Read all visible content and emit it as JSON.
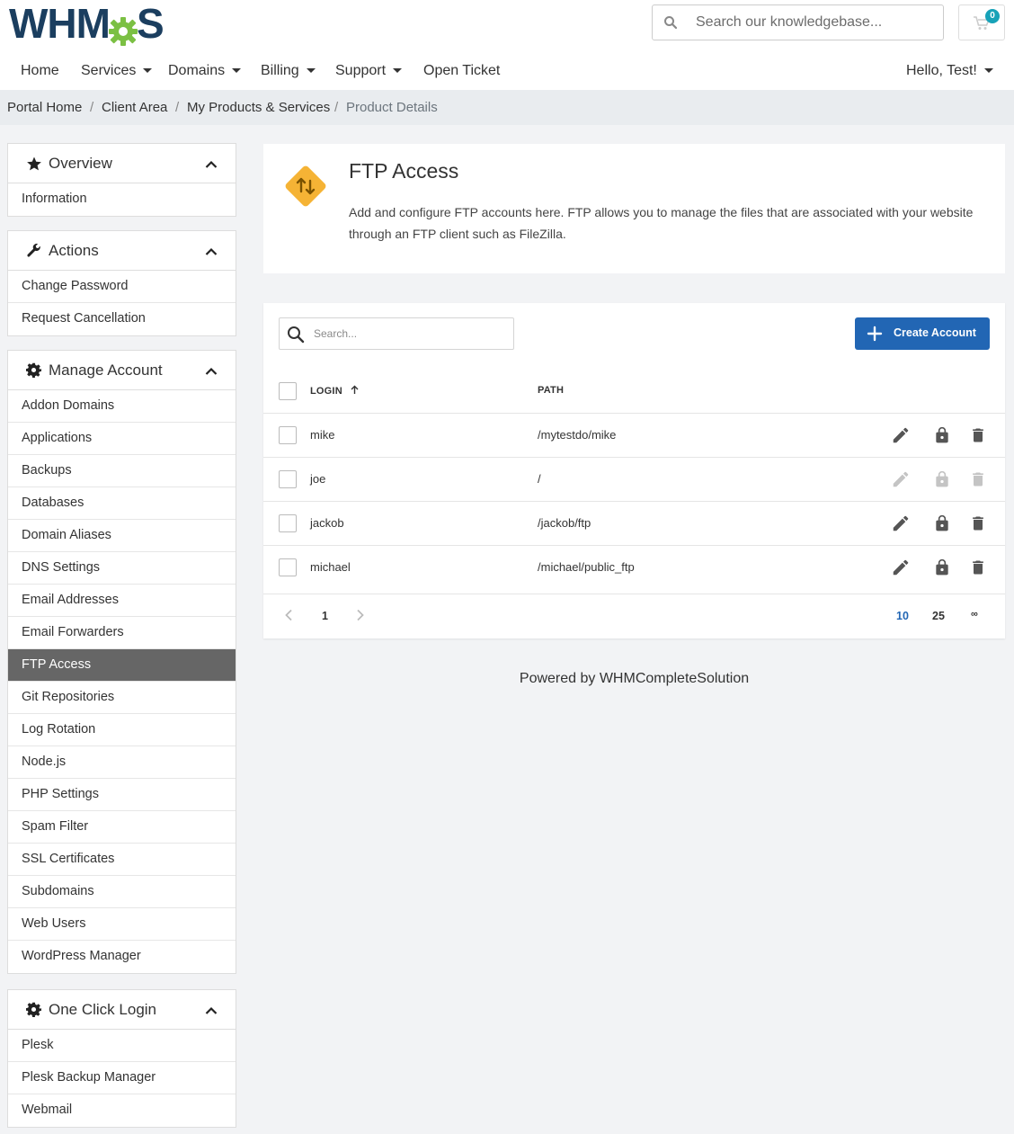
{
  "header": {
    "logo_text_left": "WHM",
    "logo_text_right": "S",
    "search_placeholder": "Search our knowledgebase...",
    "cart_count": "0"
  },
  "nav": {
    "items": [
      {
        "label": "Home"
      },
      {
        "label": "Services"
      },
      {
        "label": "Domains"
      },
      {
        "label": "Billing"
      },
      {
        "label": "Support"
      },
      {
        "label": "Open Ticket"
      }
    ],
    "user_label": "Hello, Test!"
  },
  "breadcrumb": [
    "Portal Home",
    "Client Area",
    "My Products & Services",
    "Product Details"
  ],
  "breadcrumb_sep": "/",
  "sidebar": {
    "overview": {
      "title": "Overview",
      "items": [
        "Information"
      ]
    },
    "actions": {
      "title": "Actions",
      "items": [
        "Change Password",
        "Request Cancellation"
      ]
    },
    "manage": {
      "title": "Manage Account",
      "items": [
        "Addon Domains",
        "Applications",
        "Backups",
        "Databases",
        "Domain Aliases",
        "DNS Settings",
        "Email Addresses",
        "Email Forwarders",
        "FTP Access",
        "Git Repositories",
        "Log Rotation",
        "Node.js",
        "PHP Settings",
        "Spam Filter",
        "SSL Certificates",
        "Subdomains",
        "Web Users",
        "WordPress Manager"
      ],
      "active": "FTP Access"
    },
    "oneclick": {
      "title": "One Click Login",
      "items": [
        "Plesk",
        "Plesk Backup Manager",
        "Webmail"
      ]
    }
  },
  "page": {
    "title": "FTP Access",
    "description": "Add and configure FTP accounts here. FTP allows you to manage the files that are associated with your website through an FTP client such as FileZilla."
  },
  "table": {
    "search_placeholder": "Search...",
    "create_label": "Create Account",
    "col_login": "LOGIN",
    "col_path": "PATH",
    "rows": [
      {
        "login": "mike",
        "path": "/mytestdo/mike",
        "actions_enabled": true
      },
      {
        "login": "joe",
        "path": "/",
        "actions_enabled": false
      },
      {
        "login": "jackob",
        "path": "/jackob/ftp",
        "actions_enabled": true
      },
      {
        "login": "michael",
        "path": "/michael/public_ftp",
        "actions_enabled": true
      }
    ],
    "pagination": {
      "current_page": "1",
      "page_sizes": [
        "10",
        "25",
        "∞"
      ],
      "selected_size": "10"
    }
  },
  "footer": {
    "powered_by": "Powered by WHMCompleteSolution"
  },
  "colors": {
    "brand": "#1b3e5f",
    "gear": "#7bc043",
    "primary": "#2266b4",
    "active_nav": "#666666",
    "icon_active": "#555555",
    "icon_disabled": "#c4c4c4"
  }
}
